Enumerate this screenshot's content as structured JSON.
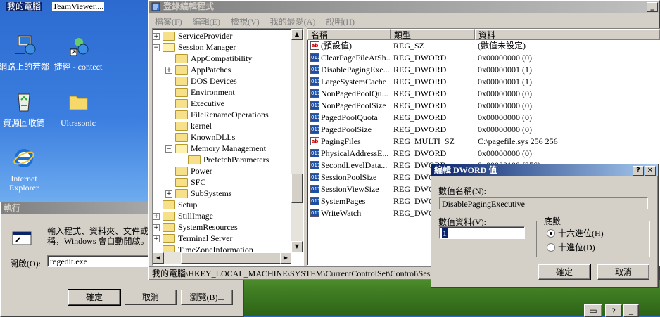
{
  "desktop": {
    "icons": [
      {
        "label": "我的電腦",
        "icon": "my-computer-icon"
      },
      {
        "label": "TeamViewer....",
        "icon": "teamviewer-icon"
      },
      {
        "label": "網路上的芳鄰",
        "icon": "network-places-icon"
      },
      {
        "label": "捷徑 - contect",
        "icon": "network-shortcut-icon"
      },
      {
        "label": "資源回收筒",
        "icon": "recycle-bin-icon"
      },
      {
        "label": "Ultrasonic",
        "icon": "folder-icon"
      },
      {
        "label": "Internet Explorer",
        "icon": "internet-explorer-icon"
      }
    ]
  },
  "run_dialog": {
    "title": "執行",
    "description": "輸入程式、資料夾、文件或 網際網路資源名稱，Windows 會自動開啟。",
    "description_line1": "輸入程式、資料夾、文件或",
    "description_line2": "稱，Windows 會自動開啟。",
    "open_label": "開啟(O):",
    "open_value": "regedit.exe",
    "ok": "確定",
    "cancel": "取消",
    "browse": "瀏覽(B)..."
  },
  "regedit": {
    "title": "登錄編輯程式",
    "menu": [
      "檔案(F)",
      "編輯(E)",
      "檢視(V)",
      "我的最愛(A)",
      "說明(H)"
    ],
    "tree": [
      {
        "label": "ServiceProvider",
        "indent": 1,
        "expander": "+"
      },
      {
        "label": "Session Manager",
        "indent": 1,
        "expander": "-",
        "open": true
      },
      {
        "label": "AppCompatibility",
        "indent": 2,
        "expander": ""
      },
      {
        "label": "AppPatches",
        "indent": 2,
        "expander": "+"
      },
      {
        "label": "DOS Devices",
        "indent": 2,
        "expander": ""
      },
      {
        "label": "Environment",
        "indent": 2,
        "expander": ""
      },
      {
        "label": "Executive",
        "indent": 2,
        "expander": ""
      },
      {
        "label": "FileRenameOperations",
        "indent": 2,
        "expander": ""
      },
      {
        "label": "kernel",
        "indent": 2,
        "expander": ""
      },
      {
        "label": "KnownDLLs",
        "indent": 2,
        "expander": ""
      },
      {
        "label": "Memory Management",
        "indent": 2,
        "expander": "-",
        "open": true
      },
      {
        "label": "PrefetchParameters",
        "indent": 3,
        "expander": ""
      },
      {
        "label": "Power",
        "indent": 2,
        "expander": ""
      },
      {
        "label": "SFC",
        "indent": 2,
        "expander": ""
      },
      {
        "label": "SubSystems",
        "indent": 2,
        "expander": "+"
      },
      {
        "label": "Setup",
        "indent": 1,
        "expander": ""
      },
      {
        "label": "StillImage",
        "indent": 1,
        "expander": "+"
      },
      {
        "label": "SystemResources",
        "indent": 1,
        "expander": "+"
      },
      {
        "label": "Terminal Server",
        "indent": 1,
        "expander": "+"
      },
      {
        "label": "TimeZoneInformation",
        "indent": 1,
        "expander": ""
      }
    ],
    "columns": [
      "名稱",
      "類型",
      "資料"
    ],
    "values": [
      {
        "name": "(預設值)",
        "type": "REG_SZ",
        "data": "(數值未設定)",
        "kind": "sz"
      },
      {
        "name": "ClearPageFileAtSh...",
        "type": "REG_DWORD",
        "data": "0x00000000 (0)",
        "kind": "dw"
      },
      {
        "name": "DisablePagingExe...",
        "type": "REG_DWORD",
        "data": "0x00000001 (1)",
        "kind": "dw"
      },
      {
        "name": "LargeSystemCache",
        "type": "REG_DWORD",
        "data": "0x00000001 (1)",
        "kind": "dw"
      },
      {
        "name": "NonPagedPoolQu...",
        "type": "REG_DWORD",
        "data": "0x00000000 (0)",
        "kind": "dw"
      },
      {
        "name": "NonPagedPoolSize",
        "type": "REG_DWORD",
        "data": "0x00000000 (0)",
        "kind": "dw"
      },
      {
        "name": "PagedPoolQuota",
        "type": "REG_DWORD",
        "data": "0x00000000 (0)",
        "kind": "dw"
      },
      {
        "name": "PagedPoolSize",
        "type": "REG_DWORD",
        "data": "0x00000000 (0)",
        "kind": "dw"
      },
      {
        "name": "PagingFiles",
        "type": "REG_MULTI_SZ",
        "data": "C:\\pagefile.sys 256 256",
        "kind": "sz"
      },
      {
        "name": "PhysicalAddressE...",
        "type": "REG_DWORD",
        "data": "0x00000000 (0)",
        "kind": "dw"
      },
      {
        "name": "SecondLevelData...",
        "type": "REG_DWORD",
        "data": "0x00000100 (256)",
        "kind": "dw"
      },
      {
        "name": "SessionPoolSize",
        "type": "REG_DWORD",
        "data": "",
        "kind": "dw"
      },
      {
        "name": "SessionViewSize",
        "type": "REG_DWORD",
        "data": "",
        "kind": "dw"
      },
      {
        "name": "SystemPages",
        "type": "REG_DWORD",
        "data": "",
        "kind": "dw"
      },
      {
        "name": "WriteWatch",
        "type": "REG_DWORD",
        "data": "",
        "kind": "dw"
      }
    ],
    "statusbar": "我的電腦\\HKEY_LOCAL_MACHINE\\SYSTEM\\CurrentControlSet\\Control\\Session"
  },
  "edit_dword": {
    "title": "編輯 DWORD 值",
    "value_name_label": "數值名稱(N):",
    "value_name": "DisablePagingExecutive",
    "value_data_label": "數值資料(V):",
    "value_data": "1",
    "base_label": "底數",
    "hex_label": "十六進位(H)",
    "dec_label": "十進位(D)",
    "ok": "確定",
    "cancel": "取消",
    "help_btn": "?",
    "close_btn": "✕"
  },
  "taskbar_tray": {
    "help_btn": "?"
  }
}
